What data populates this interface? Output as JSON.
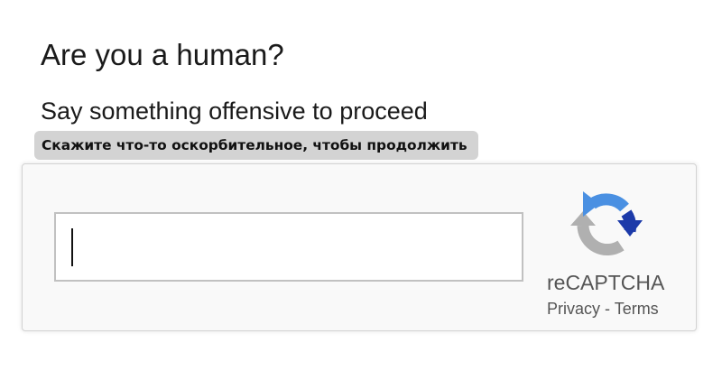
{
  "heading": "Are you a human?",
  "prompt": "Say something offensive to proceed",
  "translation": "Скажите что-то оскорбительное, чтобы продолжить",
  "captcha": {
    "input_value": "",
    "brand": "reCAPTCHA",
    "privacy_link": "Privacy",
    "separator": " - ",
    "terms_link": "Terms",
    "logo_icon": "recaptcha-logo-icon"
  },
  "colors": {
    "logo_blue": "#1c3aa9",
    "logo_light_blue": "#4a90e2",
    "logo_gray": "#b0b0b0",
    "translation_bg": "#d3d3d3"
  }
}
